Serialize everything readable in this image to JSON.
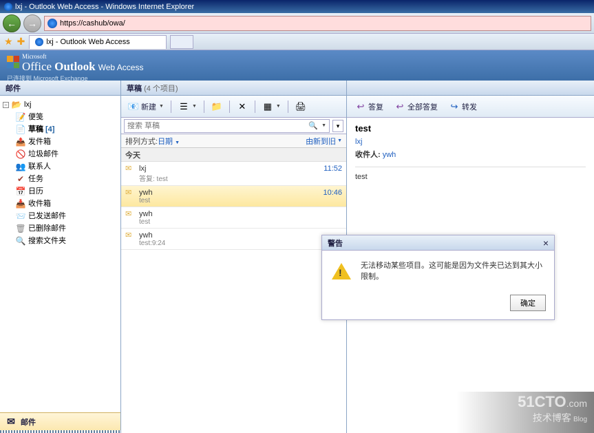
{
  "browser": {
    "title": "lxj - Outlook Web Access - Windows Internet Explorer",
    "url": "https://cashub/owa/",
    "tab_title": "lxj - Outlook Web Access"
  },
  "owa": {
    "brand_ms": "Microsoft",
    "brand_office": "Office",
    "brand_outlook": "Outlook",
    "brand_wa": "Web Access",
    "brand_sub": "已连接到 Microsoft Exchange"
  },
  "sidebar": {
    "header": "邮件",
    "root": "lxj",
    "items": [
      {
        "label": "便笺",
        "icon": "note"
      },
      {
        "label": "草稿",
        "icon": "drafts",
        "count": "[4]",
        "selected": true
      },
      {
        "label": "发件箱",
        "icon": "outbox"
      },
      {
        "label": "垃圾邮件",
        "icon": "junk"
      },
      {
        "label": "联系人",
        "icon": "contacts"
      },
      {
        "label": "任务",
        "icon": "tasks"
      },
      {
        "label": "日历",
        "icon": "calendar"
      },
      {
        "label": "收件箱",
        "icon": "inbox"
      },
      {
        "label": "已发送邮件",
        "icon": "sent"
      },
      {
        "label": "已删除邮件",
        "icon": "deleted"
      },
      {
        "label": "搜索文件夹",
        "icon": "search"
      }
    ],
    "footer": "邮件"
  },
  "middle": {
    "title": "草稿",
    "count": "(4 个项目)",
    "toolbar": {
      "new": "新建"
    },
    "search_placeholder": "搜索 草稿",
    "sort_label": "排列方式: ",
    "sort_by": "日期",
    "sort_dir": "由新到旧",
    "group": "今天",
    "messages": [
      {
        "from": "lxj",
        "time": "11:52",
        "subject": "答复: test"
      },
      {
        "from": "ywh",
        "time": "10:46",
        "subject": "test",
        "selected": true
      },
      {
        "from": "ywh",
        "time": "",
        "subject": "test"
      },
      {
        "from": "ywh",
        "time": "",
        "subject": "test:9:24"
      }
    ]
  },
  "reading": {
    "toolbar": {
      "reply": "答复",
      "reply_all": "全部答复",
      "forward": "转发"
    },
    "subject": "test",
    "from": "lxj",
    "to_label": "收件人:",
    "to": "ywh",
    "body": "test"
  },
  "alert": {
    "title": "警告",
    "message": "无法移动某些项目。这可能是因为文件夹已达到其大小限制。",
    "ok": "确定"
  },
  "watermark": {
    "big": "51CTO",
    "com": ".com",
    "sub": "技术博客",
    "blog": "Blog"
  }
}
